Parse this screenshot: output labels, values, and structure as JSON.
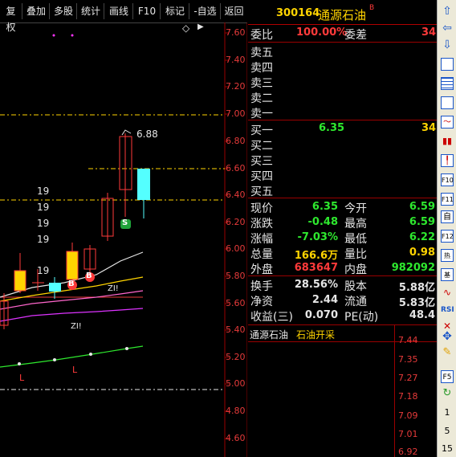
{
  "toolbar": {
    "buttons": [
      "复权",
      "叠加",
      "多股",
      "统计",
      "画线",
      "F10",
      "标记",
      "-自选",
      "返回"
    ]
  },
  "chart": {
    "price_axis": [
      "7.60",
      "7.40",
      "7.20",
      "7.00",
      "6.80",
      "6.60",
      "6.40",
      "6.20",
      "6.00",
      "5.80",
      "5.60",
      "5.40",
      "5.20",
      "5.00",
      "4.80",
      "4.60"
    ],
    "high_label": "6.88",
    "vol_labels": [
      "19",
      "19",
      "19",
      "19",
      "19"
    ],
    "markers": {
      "b1": "B",
      "b2": "B",
      "s1": "S",
      "zi1": "ZI!",
      "zi2": "ZI!",
      "l1": "L",
      "l2": "L"
    },
    "diamond": "◇",
    "nav_arrow": "▶"
  },
  "quote": {
    "code": "300164",
    "name": "通源石油",
    "badge": "B",
    "weibi_label": "委比",
    "weibi_value": "100.00%",
    "weicha_label": "委差",
    "weicha_value": "34",
    "sell": [
      "卖五",
      "卖四",
      "卖三",
      "卖二",
      "卖一"
    ],
    "buy": [
      "买一",
      "买二",
      "买三",
      "买四",
      "买五"
    ],
    "buy1_price": "6.35",
    "buy1_vol": "34",
    "stats": [
      {
        "l1": "现价",
        "v1": "6.35",
        "c1": "green",
        "l2": "今开",
        "v2": "6.59",
        "c2": "green"
      },
      {
        "l1": "涨跌",
        "v1": "-0.48",
        "c1": "green",
        "l2": "最高",
        "v2": "6.59",
        "c2": "green"
      },
      {
        "l1": "涨幅",
        "v1": "-7.03%",
        "c1": "green",
        "l2": "最低",
        "v2": "6.22",
        "c2": "green"
      },
      {
        "l1": "总量",
        "v1": "166.6万",
        "c1": "yellow",
        "l2": "量比",
        "v2": "0.98",
        "c2": "yellow"
      },
      {
        "l1": "外盘",
        "v1": "683647",
        "c1": "red",
        "l2": "内盘",
        "v2": "982092",
        "c2": "green"
      }
    ],
    "stats2": [
      {
        "l1": "换手",
        "v1": "28.56%",
        "l2": "股本",
        "v2": "5.88亿"
      },
      {
        "l1": "净资",
        "v1": "2.44",
        "l2": "流通",
        "v2": "5.83亿"
      },
      {
        "l1": "收益(三)",
        "v1": "0.070",
        "l2": "PE(动)",
        "v2": "48.4"
      }
    ],
    "tabs": [
      "通源石油",
      "石油开采"
    ],
    "mini_axis": [
      "7.44",
      "7.35",
      "7.27",
      "7.18",
      "7.09",
      "7.01",
      "6.92"
    ]
  },
  "sidebar": {
    "icons": [
      "up-arrow-icon",
      "left-arrow-icon",
      "down-arrow-icon",
      "quote-list-icon",
      "table-icon",
      "grid-icon",
      "line-chart-icon",
      "candle-chart-icon",
      "k-chart-icon",
      "f10-icon",
      "f11-icon",
      "self-select-icon",
      "f12-icon",
      "hot-icon",
      "fund-icon",
      "wave-icon",
      "rsi-icon",
      "tools-icon",
      "move-icon",
      "pencil-icon",
      "f5-icon",
      "refresh-icon"
    ],
    "numbers": [
      "1",
      "5",
      "15"
    ]
  },
  "colors": {
    "up_red": "#ff3a3a",
    "down_cyan": "#54ffff",
    "grid_red": "#9a0000",
    "axis_red": "#e63a3a",
    "yellow": "#ffd400",
    "green": "#2ee82e"
  }
}
